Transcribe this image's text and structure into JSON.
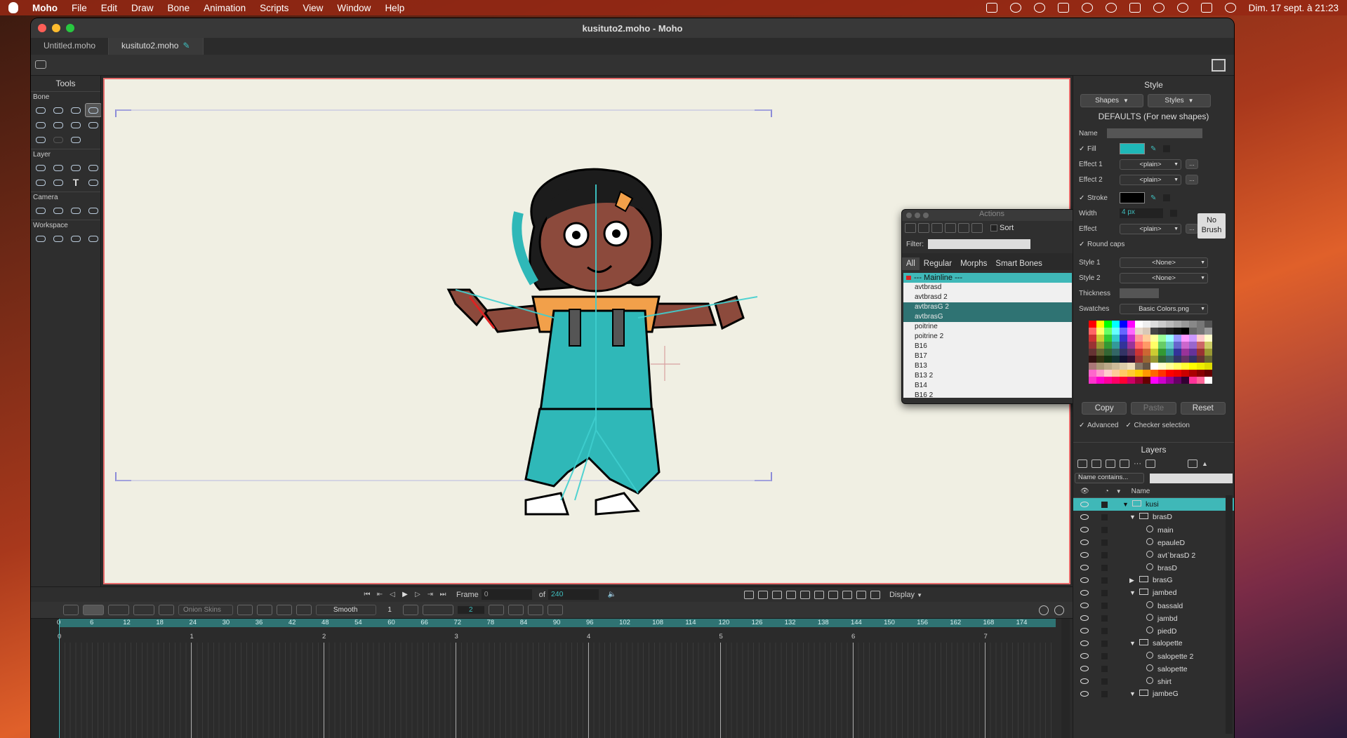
{
  "menubar": {
    "app": "Moho",
    "items": [
      "File",
      "Edit",
      "Draw",
      "Bone",
      "Animation",
      "Scripts",
      "View",
      "Window",
      "Help"
    ],
    "clock": "Dim. 17 sept. à 21:23"
  },
  "window": {
    "title": "kusituto2.moho - Moho",
    "tabs": [
      {
        "label": "Untitled.moho"
      },
      {
        "label": "kusituto2.moho"
      }
    ]
  },
  "tools": {
    "title": "Tools",
    "sections": [
      "Bone",
      "Layer",
      "Camera",
      "Workspace"
    ],
    "text_tool": "T"
  },
  "actions": {
    "title": "Actions",
    "sort_label": "Sort",
    "filter_label": "Filter:",
    "tabs": [
      "All",
      "Regular",
      "Morphs",
      "Smart Bones"
    ],
    "items": [
      "--- Mainline ---",
      "avtbrasd",
      "avtbrasd 2",
      "avtbrasG 2",
      "avtbrasG",
      "poitrine",
      "poitrine 2",
      "B16",
      "B17",
      "B13",
      "B13 2",
      "B14",
      "B16 2"
    ]
  },
  "style": {
    "title": "Style",
    "shapes_btn": "Shapes",
    "styles_btn": "Styles",
    "defaults": "DEFAULTS (For new shapes)",
    "name_label": "Name",
    "fill_label": "Fill",
    "effect1_label": "Effect 1",
    "effect1_value": "<plain>",
    "effect2_label": "Effect 2",
    "effect2_value": "<plain>",
    "stroke_label": "Stroke",
    "width_label": "Width",
    "width_value": "4 px",
    "effect_label": "Effect",
    "effect_value": "<plain>",
    "no_brush": "No Brush",
    "round_caps": "Round caps",
    "style1_label": "Style 1",
    "style1_value": "<None>",
    "style2_label": "Style 2",
    "style2_value": "<None>",
    "thickness_label": "Thickness",
    "swatches_label": "Swatches",
    "swatches_value": "Basic Colors.png",
    "copy": "Copy",
    "paste": "Paste",
    "reset": "Reset",
    "advanced": "Advanced",
    "checker": "Checker selection",
    "fill_color": "#1fb8b8",
    "stroke_color": "#000000"
  },
  "layers": {
    "title": "Layers",
    "filter_mode": "Name contains...",
    "col_name": "Name",
    "rows": [
      {
        "name": "kusi",
        "type": "bone",
        "depth": 0,
        "expanded": true,
        "selected": true
      },
      {
        "name": "brasD",
        "type": "group",
        "depth": 1,
        "expanded": true
      },
      {
        "name": "main",
        "type": "vector",
        "depth": 2
      },
      {
        "name": "epauleD",
        "type": "vector",
        "depth": 2
      },
      {
        "name": "avt`brasD 2",
        "type": "vector",
        "depth": 2
      },
      {
        "name": "brasD",
        "type": "vector",
        "depth": 2
      },
      {
        "name": "brasG",
        "type": "group",
        "depth": 1,
        "expanded": false
      },
      {
        "name": "jambed",
        "type": "group",
        "depth": 1,
        "expanded": true
      },
      {
        "name": "bassald",
        "type": "vector",
        "depth": 2
      },
      {
        "name": "jambd",
        "type": "vector",
        "depth": 2
      },
      {
        "name": "piedD",
        "type": "vector",
        "depth": 2
      },
      {
        "name": "salopette",
        "type": "group",
        "depth": 1,
        "expanded": true
      },
      {
        "name": "salopette 2",
        "type": "vector",
        "depth": 2
      },
      {
        "name": "salopette",
        "type": "vector",
        "depth": 2
      },
      {
        "name": "shirt",
        "type": "vector",
        "depth": 2
      },
      {
        "name": "jambeG",
        "type": "group",
        "depth": 1,
        "expanded": true
      }
    ]
  },
  "playback": {
    "frame_label": "Frame",
    "frame_value": "0",
    "of_label": "of",
    "total_frames": "240",
    "display_label": "Display"
  },
  "timeline": {
    "onion_skins": "Onion Skins",
    "interp": "Smooth",
    "interp_num": "1",
    "step_num": "2",
    "frame_ticks": [
      "0",
      "6",
      "12",
      "18",
      "24",
      "30",
      "36",
      "42",
      "48",
      "54",
      "60",
      "66",
      "72",
      "78",
      "84",
      "90",
      "96",
      "102",
      "108",
      "114",
      "120",
      "126",
      "132",
      "138",
      "144",
      "150",
      "156",
      "162",
      "168",
      "174"
    ],
    "seconds": [
      "0",
      "1",
      "2",
      "3",
      "4",
      "5",
      "6",
      "7"
    ]
  }
}
